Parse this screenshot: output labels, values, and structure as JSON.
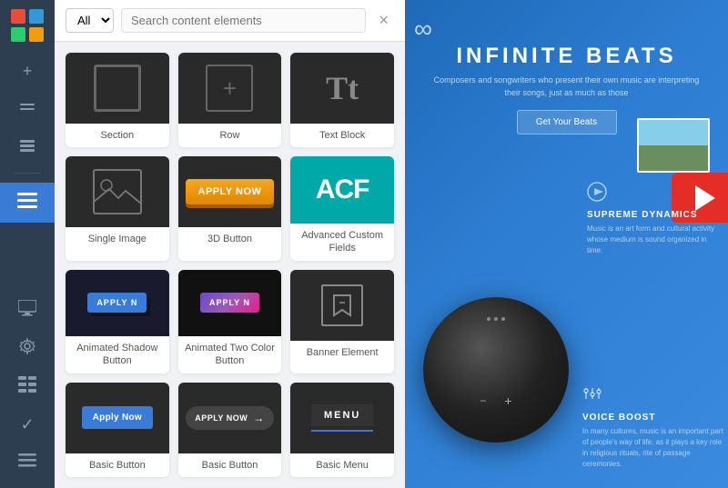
{
  "sidebar": {
    "logo_colors": [
      "#e74c3c",
      "#3498db",
      "#2ecc71",
      "#f39c12"
    ],
    "items": [
      {
        "name": "add",
        "icon": "+",
        "active": false
      },
      {
        "name": "layers",
        "icon": "⊟",
        "active": false
      },
      {
        "name": "stack",
        "icon": "≡",
        "active": false
      },
      {
        "name": "menu-toggle",
        "icon": "☰",
        "active": true
      },
      {
        "name": "desktop",
        "icon": "⬜",
        "active": false
      },
      {
        "name": "settings",
        "icon": "⚙",
        "active": false
      },
      {
        "name": "layout",
        "icon": "⊞",
        "active": false
      },
      {
        "name": "check",
        "icon": "✓",
        "active": false
      },
      {
        "name": "list",
        "icon": "≡",
        "active": false
      }
    ]
  },
  "panel": {
    "filter_label": "All",
    "search_placeholder": "Search content elements",
    "close_icon": "×"
  },
  "elements": [
    {
      "id": "section",
      "label": "Section",
      "type": "section"
    },
    {
      "id": "row",
      "label": "Row",
      "type": "row"
    },
    {
      "id": "text-block",
      "label": "Text Block",
      "type": "text"
    },
    {
      "id": "single-image",
      "label": "Single Image",
      "type": "image"
    },
    {
      "id": "3d-button",
      "label": "3D Button",
      "type": "3d-btn",
      "button_text": "APPLY NOW"
    },
    {
      "id": "acf",
      "label": "Advanced Custom Fields",
      "type": "acf",
      "text": "ACF"
    },
    {
      "id": "animated-shadow",
      "label": "Animated Shadow Button",
      "type": "anim-shadow",
      "button_text": "APPLY N"
    },
    {
      "id": "animated-two",
      "label": "Animated Two Color Button",
      "type": "anim-two",
      "button_text": "APPLY N"
    },
    {
      "id": "banner",
      "label": "Banner Element",
      "type": "banner"
    },
    {
      "id": "basic-button",
      "label": "Basic Button",
      "type": "basic-blue",
      "button_text": "Apply Now"
    },
    {
      "id": "basic-button-2",
      "label": "Basic Button",
      "type": "basic-dark",
      "button_text": "APPLY NOW"
    },
    {
      "id": "basic-menu",
      "label": "Basic Menu",
      "type": "menu",
      "button_text": "MENU"
    }
  ],
  "main": {
    "infinity_symbol": "∞",
    "title": "INFINITE BEATS",
    "subtitle": "Composers and songwriters who present their own music are interpreting their songs, just as much as those",
    "cta_button": "Get Your Beats",
    "supreme_title": "SUPREME DYNAMICS",
    "supreme_text": "Music is an art form and cultural activity whose medium is sound organized in time.",
    "voice_title": "VOICE BOOST",
    "voice_text": "In many cultures, music is an important part of people's way of life, as it plays a key role in religious rituals, rite of passage ceremonies."
  }
}
